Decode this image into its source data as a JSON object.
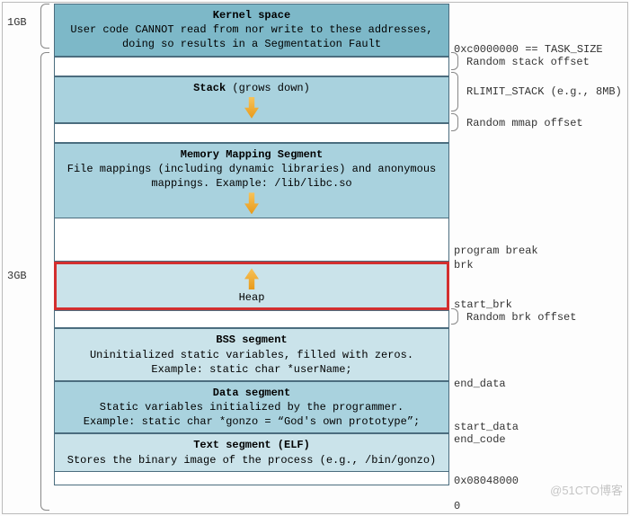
{
  "sizes": {
    "top": "1GB",
    "bottom": "3GB"
  },
  "segments": {
    "kernel": {
      "title": "Kernel space",
      "desc": "User code CANNOT read from nor write to these addresses, doing so results in a Segmentation Fault"
    },
    "stack": {
      "title": "Stack",
      "note": "(grows down)"
    },
    "mmap": {
      "title": "Memory Mapping Segment",
      "desc": "File mappings (including dynamic libraries) and anonymous mappings. Example: /lib/libc.so"
    },
    "heap": {
      "title": "Heap"
    },
    "bss": {
      "title": "BSS segment",
      "desc": "Uninitialized static variables, filled with zeros.",
      "example": "Example: static char *userName;"
    },
    "data": {
      "title": "Data segment",
      "desc": "Static variables initialized by the programmer.",
      "example": "Example: static char *gonzo = “God's own prototype”;"
    },
    "text": {
      "title": "Text segment (ELF)",
      "desc": "Stores the binary image of the process (e.g., /bin/gonzo)"
    }
  },
  "labels": {
    "task_size": "0xc0000000 == TASK_SIZE",
    "rand_stack": "Random stack offset",
    "rlimit": "RLIMIT_STACK (e.g., 8MB)",
    "rand_mmap": "Random mmap offset",
    "prog_break": "program break",
    "brk": "brk",
    "start_brk": "start_brk",
    "rand_brk": "Random brk offset",
    "end_data": "end_data",
    "start_data": "start_data",
    "end_code": "end_code",
    "addr_text": "0x08048000",
    "zero": "0"
  },
  "watermark": "@51CTO博客"
}
